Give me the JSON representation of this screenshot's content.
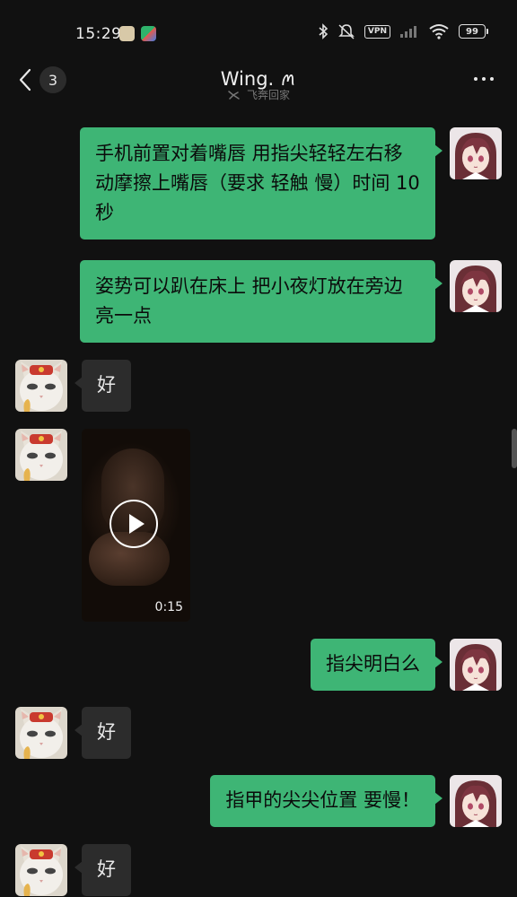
{
  "status_bar": {
    "time": "15:29",
    "vpn_label": "VPN",
    "battery": "99",
    "icons": [
      "bluetooth-icon",
      "mute-icon",
      "vpn-icon",
      "signal-icon",
      "wifi-icon",
      "battery-icon"
    ]
  },
  "header": {
    "unread_count": "3",
    "title": "Wing. ꪔ",
    "subtitle": "飞奔回家"
  },
  "messages": [
    {
      "direction": "out",
      "text": "手机前置对着嘴唇 用指尖轻轻左右移动摩擦上嘴唇（要求 轻触 慢）时间 10 秒"
    },
    {
      "direction": "out",
      "text": "姿势可以趴在床上 把小夜灯放在旁边 亮一点"
    },
    {
      "direction": "in",
      "text": "好"
    },
    {
      "direction": "in",
      "type": "video",
      "duration": "0:15"
    },
    {
      "direction": "out",
      "text": "指尖明白么"
    },
    {
      "direction": "in",
      "text": "好"
    },
    {
      "direction": "out",
      "text": "指甲的尖尖位置 要慢！"
    },
    {
      "direction": "in",
      "text": "好"
    }
  ],
  "colors": {
    "background": "#111111",
    "outgoing_bubble": "#3eb575",
    "incoming_bubble": "#2c2c2c"
  }
}
